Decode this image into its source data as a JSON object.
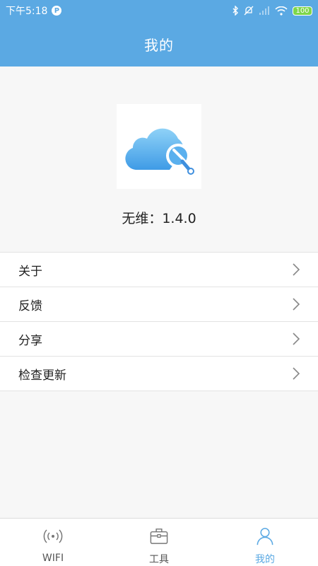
{
  "status_bar": {
    "time": "下午5:18",
    "battery": "100"
  },
  "header": {
    "title": "我的"
  },
  "app": {
    "version_text": "无维：1.4.0"
  },
  "menu": {
    "items": [
      {
        "label": "关于"
      },
      {
        "label": "反馈"
      },
      {
        "label": "分享"
      },
      {
        "label": "检查更新"
      }
    ]
  },
  "tabbar": {
    "tabs": [
      {
        "label": "WIFI",
        "icon": "wifi-signal-icon"
      },
      {
        "label": "工具",
        "icon": "toolbox-icon"
      },
      {
        "label": "我的",
        "icon": "person-icon",
        "active": true
      }
    ]
  },
  "colors": {
    "accent": "#5ba9e3",
    "background": "#f7f7f7",
    "battery": "#7ed64a"
  }
}
